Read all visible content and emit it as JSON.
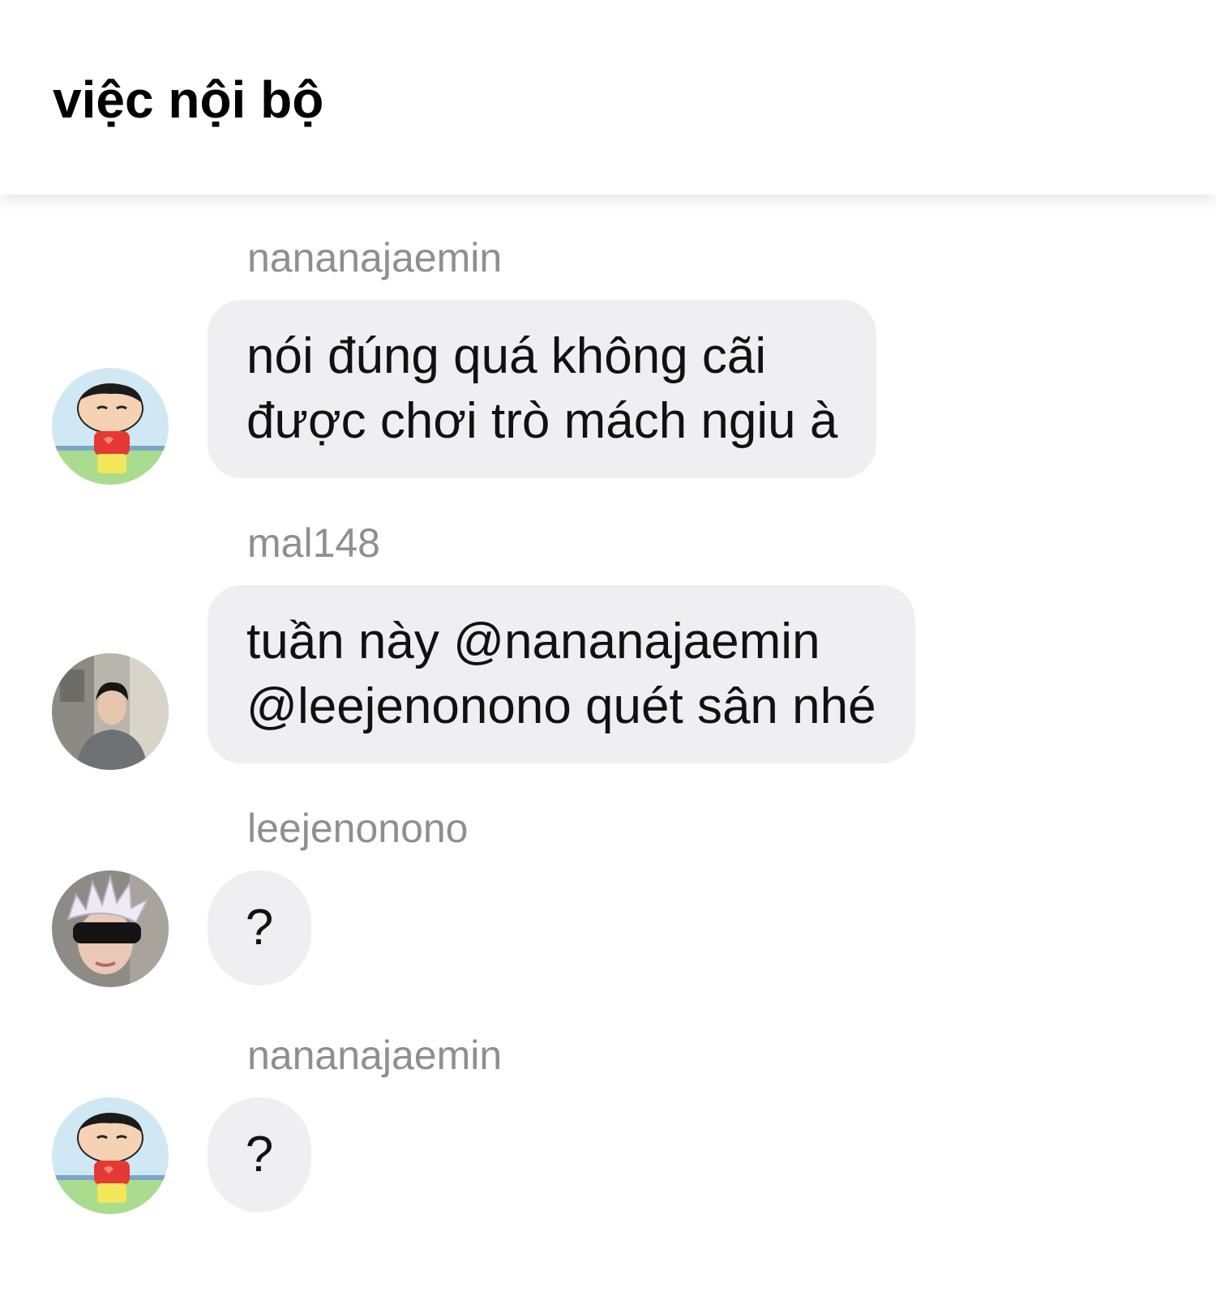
{
  "header": {
    "title": "việc nội bộ"
  },
  "messages": [
    {
      "sender": "nananajaemin",
      "avatar": "cartoon-boy-avatar",
      "lines": [
        "nói đúng quá không cãi",
        "được chơi trò mách ngiu à"
      ]
    },
    {
      "sender": "mal148",
      "avatar": "young-man-photo-avatar",
      "lines": [
        "tuần này @nananajaemin",
        "@leejenonono quét sân nhé"
      ]
    },
    {
      "sender": "leejenonono",
      "avatar": "masked-white-hair-avatar",
      "lines": [
        "?"
      ]
    },
    {
      "sender": "nananajaemin",
      "avatar": "cartoon-boy-avatar",
      "lines": [
        "?"
      ]
    }
  ],
  "colors": {
    "bubble": "#efeff1",
    "sender_text": "#8e8e93",
    "background": "#ffffff"
  }
}
